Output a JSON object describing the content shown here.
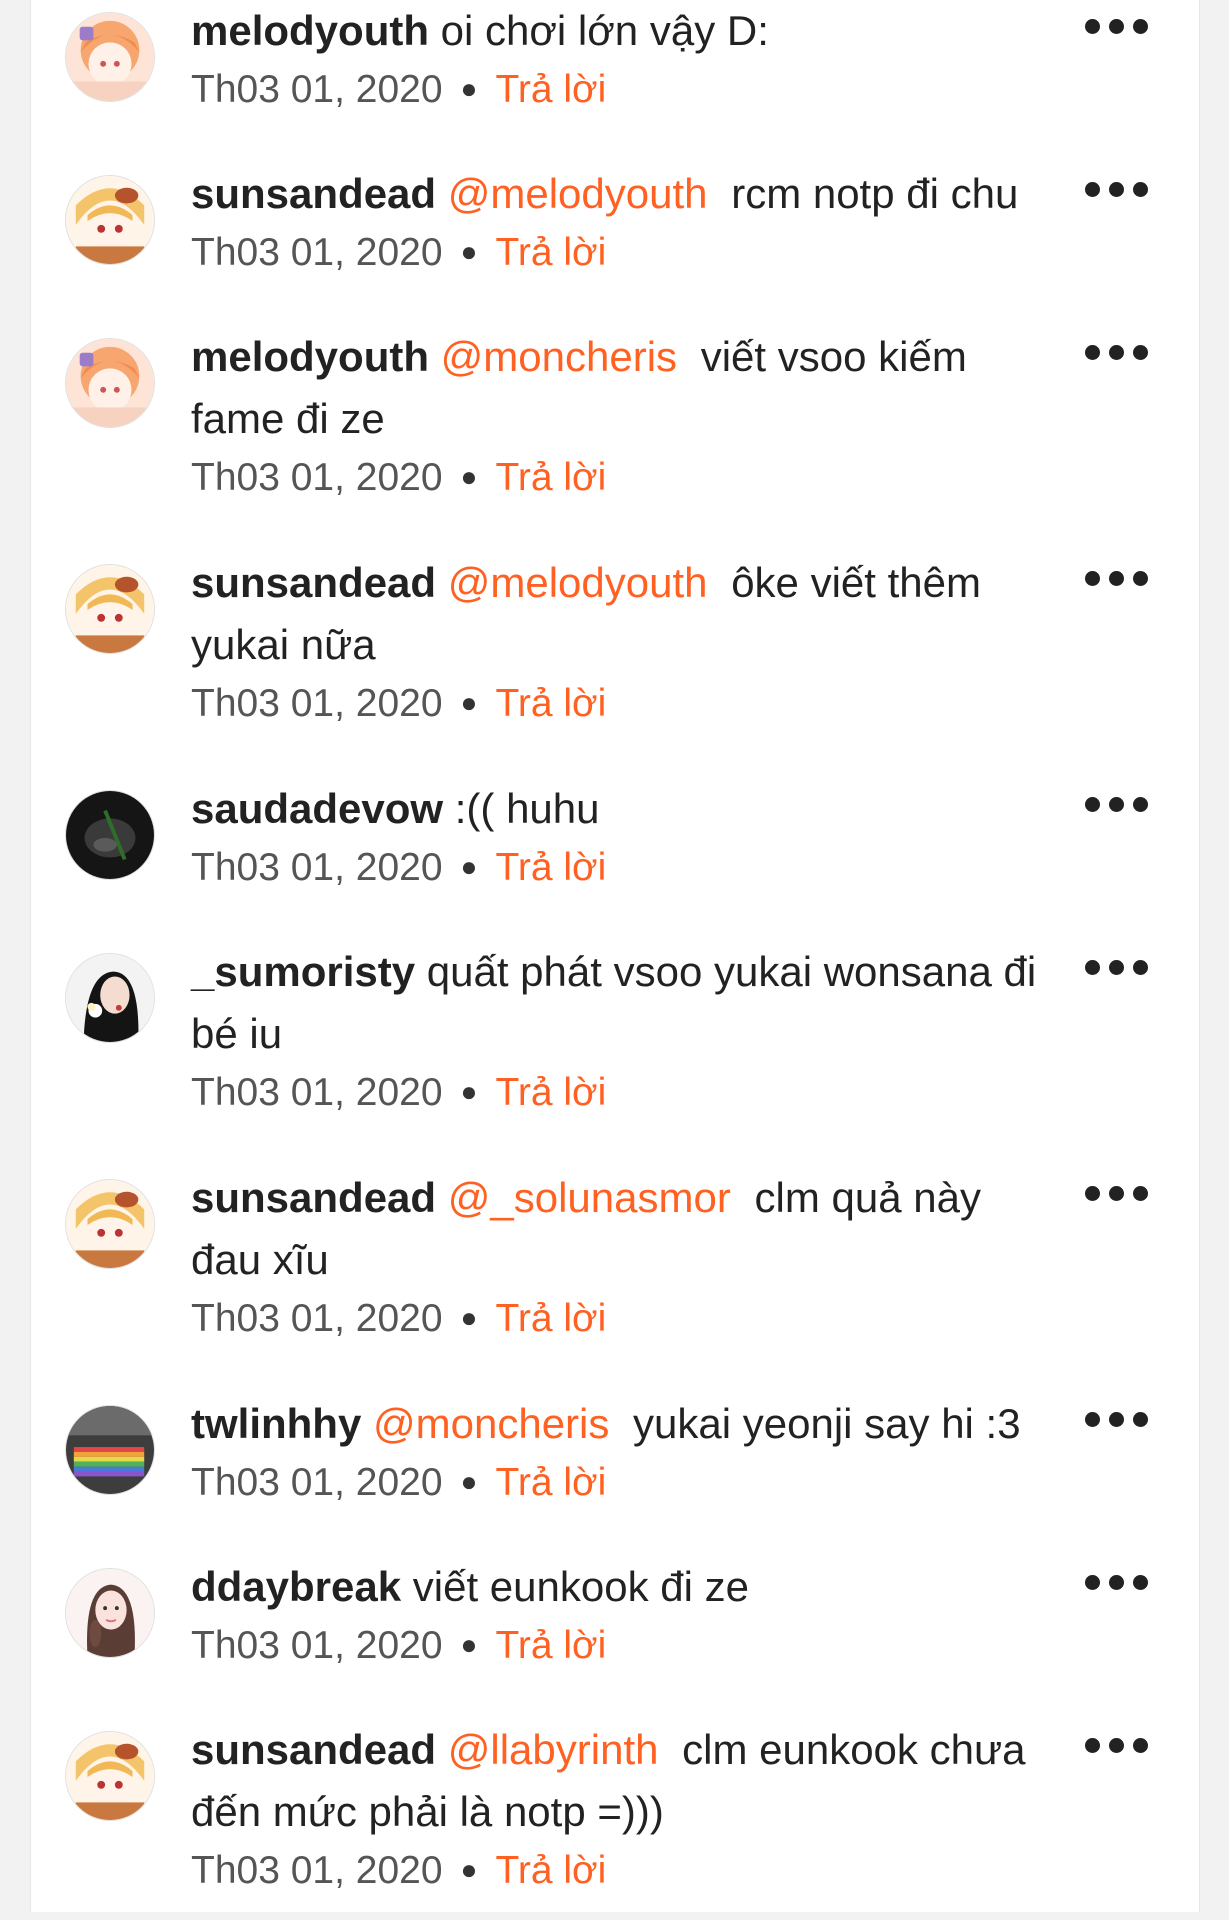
{
  "comments": [
    {
      "username": "melodyouth",
      "mention": "",
      "text": "oi chơi lớn vậy D:",
      "date": "Th03 01, 2020",
      "reply_label": "Trả lời",
      "avatar": "peach-haired-anime-avatar"
    },
    {
      "username": "sunsandead",
      "mention": "@melodyouth",
      "text": "rcm notp đi chu",
      "date": "Th03 01, 2020",
      "reply_label": "Trả lời",
      "avatar": "blonde-anime-avatar"
    },
    {
      "username": "melodyouth",
      "mention": "@moncheris",
      "text": "viết vsoo kiếm fame đi ze",
      "date": "Th03 01, 2020",
      "reply_label": "Trả lời",
      "avatar": "peach-haired-anime-avatar"
    },
    {
      "username": "sunsandead",
      "mention": "@melodyouth",
      "text": "ôke viết thêm yukai nữa",
      "date": "Th03 01, 2020",
      "reply_label": "Trả lời",
      "avatar": "blonde-anime-avatar"
    },
    {
      "username": "saudadevow",
      "mention": "",
      "text": ":(( huhu",
      "date": "Th03 01, 2020",
      "reply_label": "Trả lời",
      "avatar": "dark-photo-avatar"
    },
    {
      "username": "_sumoristy",
      "mention": "",
      "text": "quất phát vsoo yukai wonsana đi bé iu",
      "date": "Th03 01, 2020",
      "reply_label": "Trả lời",
      "avatar": "person-with-flower-avatar"
    },
    {
      "username": "sunsandead",
      "mention": "@_solunasmor",
      "text": "clm quả này đau xĩu",
      "date": "Th03 01, 2020",
      "reply_label": "Trả lời",
      "avatar": "blonde-anime-avatar"
    },
    {
      "username": "twlinhhy",
      "mention": "@moncheris",
      "text": "yukai yeonji say hi :3",
      "date": "Th03 01, 2020",
      "reply_label": "Trả lời",
      "avatar": "rainbow-photo-avatar"
    },
    {
      "username": "ddaybreak",
      "mention": "",
      "text": "viết eunkook đi ze",
      "date": "Th03 01, 2020",
      "reply_label": "Trả lời",
      "avatar": "girl-portrait-avatar"
    },
    {
      "username": "sunsandead",
      "mention": "@llabyrinth",
      "text": "clm eunkook chưa đến mức phải là notp =)))",
      "date": "Th03 01, 2020",
      "reply_label": "Trả lời",
      "avatar": "blonde-anime-avatar"
    }
  ],
  "colors": {
    "accent": "#ff6122",
    "text": "#222222",
    "meta": "#555555"
  },
  "more_icon": "more-horizontal-icon"
}
